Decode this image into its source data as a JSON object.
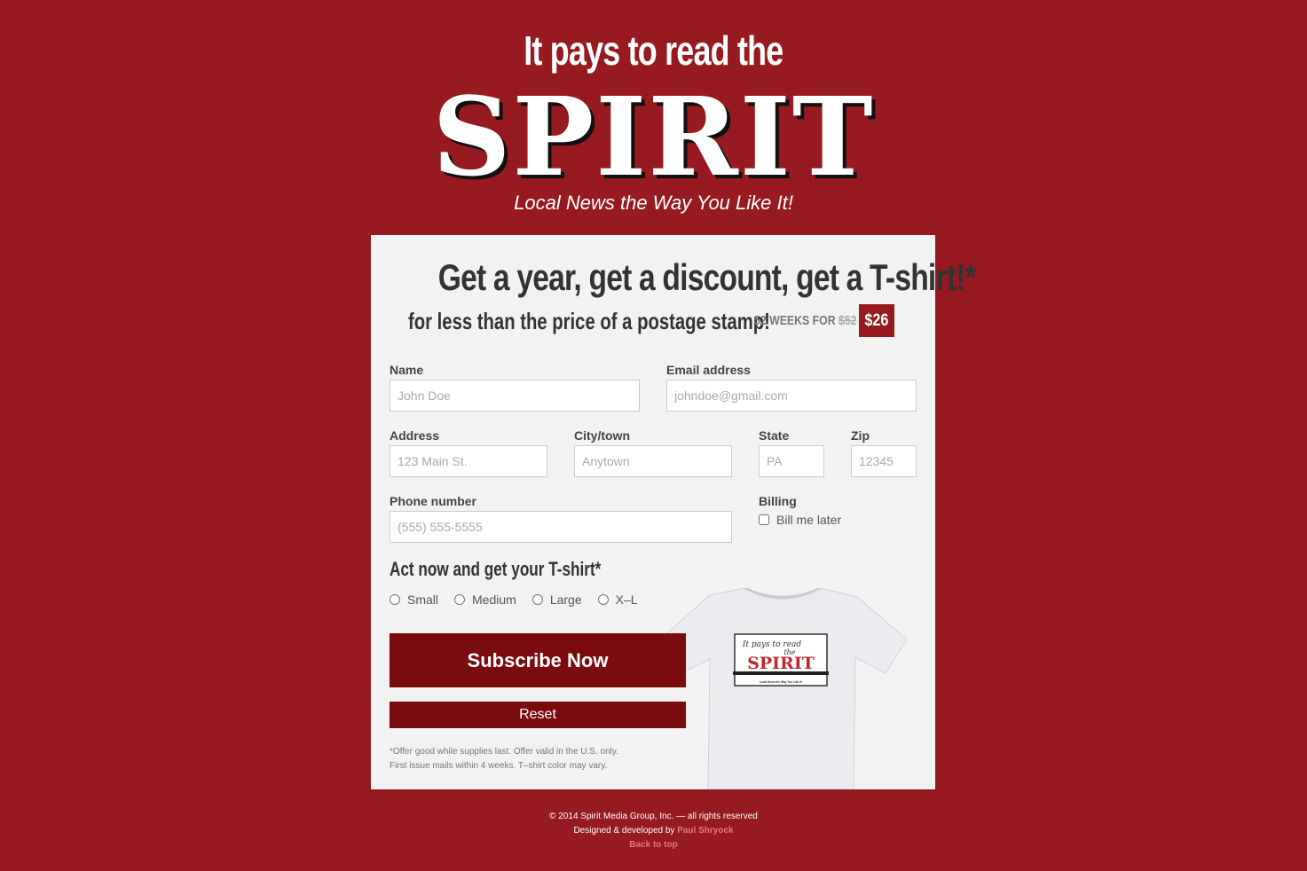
{
  "header": {
    "tagline": "It pays to read the",
    "logo": "SPIRIT",
    "subtitle": "Local News the Way You Like It!"
  },
  "offer": {
    "headline": "Get a year, get a discount, get a T-shirt!*",
    "subline": "for less than the price of a postage stamp!",
    "weeks_prefix": "52 WEEKS FOR",
    "old_price": "$52",
    "price": "$26"
  },
  "form": {
    "name": {
      "label": "Name",
      "placeholder": "John Doe"
    },
    "email": {
      "label": "Email address",
      "placeholder": "johndoe@gmail.com"
    },
    "address": {
      "label": "Address",
      "placeholder": "123 Main St."
    },
    "city": {
      "label": "City/town",
      "placeholder": "Anytown"
    },
    "state": {
      "label": "State",
      "placeholder": "PA"
    },
    "zip": {
      "label": "Zip",
      "placeholder": "12345"
    },
    "phone": {
      "label": "Phone number",
      "placeholder": "(555) 555-5555"
    },
    "billing": {
      "label": "Billing",
      "option": "Bill me later"
    },
    "tshirt_title": "Act now and get your T-shirt*",
    "sizes": [
      "Small",
      "Medium",
      "Large",
      "X–L"
    ],
    "subscribe_label": "Subscribe Now",
    "reset_label": "Reset",
    "fine_print_1": "*Offer good while supplies last. Offer valid in the U.S. only.",
    "fine_print_2": "First issue mails within 4 weeks. T–shirt color may vary."
  },
  "shirt_print": {
    "line1": "It pays to read",
    "line2": "the",
    "logo": "SPIRIT",
    "line3": "Local News the Way You Like It!"
  },
  "footer": {
    "copyright": "© 2014 Spirit Media Group, Inc. — all rights reserved",
    "designed_by": "Designed & developed by",
    "designer": "Paul Shryock",
    "back_to_top": "Back to top"
  },
  "colors": {
    "background": "#961a1f",
    "button": "#7a0b0e",
    "card": "#f2f2f2"
  }
}
